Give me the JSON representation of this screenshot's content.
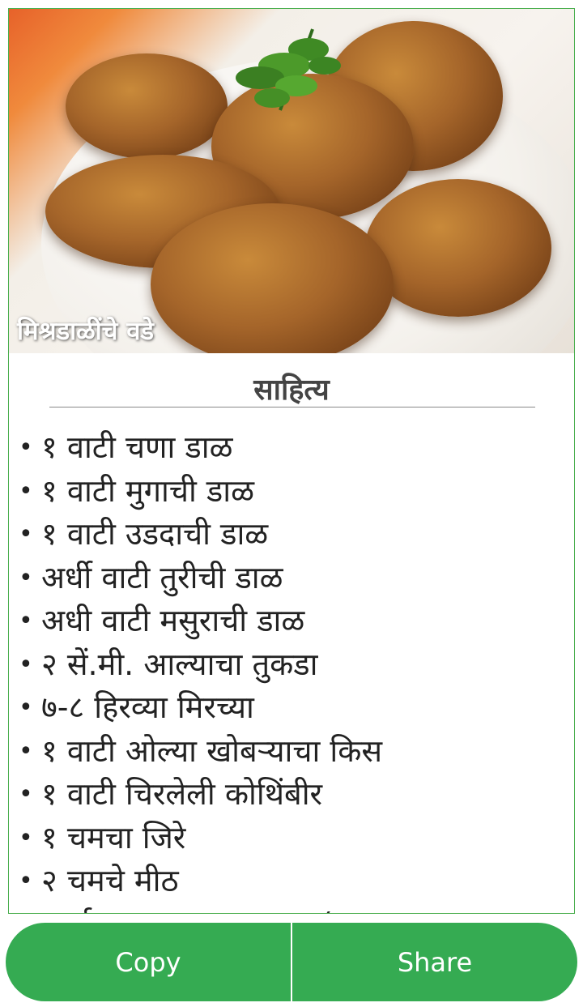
{
  "recipe": {
    "title": "मिश्रडाळींचे वडे",
    "section_heading": "साहित्य",
    "ingredients": [
      "१ वाटी चणा डाळ",
      "१ वाटी मुगाची डाळ",
      "१ वाटी उडदाची डाळ",
      "अर्धी वाटी तुरीची डाळ",
      "अधी वाटी मसुराची डाळ",
      "२ सें.मी. आल्याचा तुकडा",
      "७-८ हिरव्या मिरच्या",
      "१ वाटी ओल्या खोबऱ्याचा किस",
      "१ वाटी चिरलेली कोथिंबीर",
      "१ चमचा जिरे",
      "२ चमचे मीठ",
      "अर्धा चमचा गरम मसाला (आवश्यकता"
    ]
  },
  "actions": {
    "copy_label": "Copy",
    "share_label": "Share"
  },
  "colors": {
    "button_green": "#35ab52",
    "card_border": "#4caf50"
  }
}
